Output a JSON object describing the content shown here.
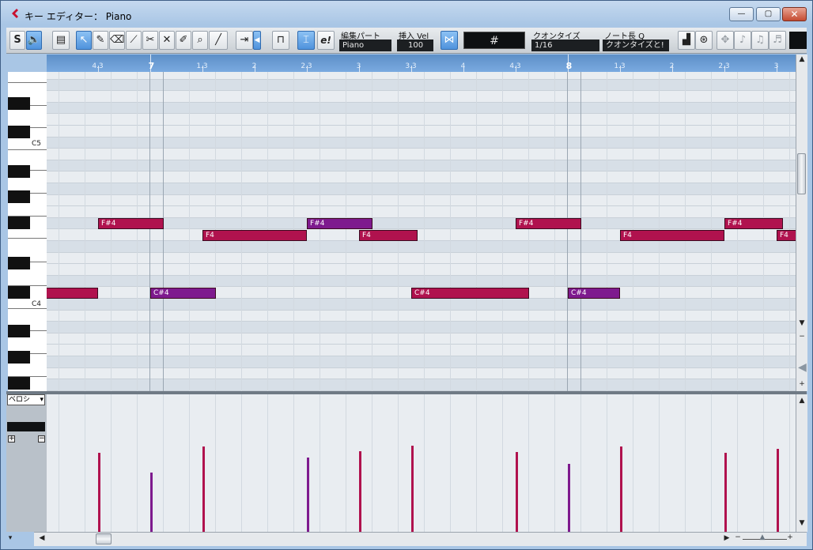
{
  "window": {
    "title": "キー エディター： Piano",
    "minimize_label": "—",
    "maximize_label": "▢",
    "close_label": "✕"
  },
  "toolbar": {
    "solo_label": "S",
    "edit_part_label": "編集パート",
    "edit_part_value": "Piano",
    "insert_vel_label": "挿入 Vel",
    "insert_vel_value": "100",
    "grid_symbol": "#",
    "quantize_label": "クオンタイズ",
    "quantize_value": "1/16",
    "note_length_label": "ノート長 Q",
    "note_length_value": "クオンタイズと!",
    "eu_label": "e!"
  },
  "ruler": {
    "labels": [
      {
        "text": "4.3",
        "bar": false
      },
      {
        "text": "7",
        "bar": true
      },
      {
        "text": "1.3",
        "bar": false
      },
      {
        "text": "2",
        "bar": false
      },
      {
        "text": "2.3",
        "bar": false
      },
      {
        "text": "3",
        "bar": false
      },
      {
        "text": "3.3",
        "bar": false
      },
      {
        "text": "4",
        "bar": false
      },
      {
        "text": "4.3",
        "bar": false
      },
      {
        "text": "8",
        "bar": true
      },
      {
        "text": "1.3",
        "bar": false
      },
      {
        "text": "2",
        "bar": false
      },
      {
        "text": "2.3",
        "bar": false
      },
      {
        "text": "3",
        "bar": false
      }
    ]
  },
  "keyboard": {
    "c5_label": "C5",
    "c4_label": "C4"
  },
  "notes": [
    {
      "pitch": "F#4",
      "label": "F#4",
      "start": 4.375,
      "length": 0.625,
      "color": "#b0124e"
    },
    {
      "pitch": "F4",
      "label": "F4",
      "start": 5.375,
      "length": 1.0,
      "color": "#b0124e"
    },
    {
      "pitch": "F#4",
      "label": "F#4",
      "start": 6.375,
      "length": 0.625,
      "color": "#7e1a8e"
    },
    {
      "pitch": "F4",
      "label": "F4",
      "start": 6.875,
      "length": 0.5625,
      "color": "#b0124e"
    },
    {
      "pitch": "F#4",
      "label": "F#4",
      "start": 8.375,
      "length": 0.625,
      "color": "#b0124e"
    },
    {
      "pitch": "F4",
      "label": "F4",
      "start": 9.375,
      "length": 1.0,
      "color": "#b0124e"
    },
    {
      "pitch": "F#4",
      "label": "F#4",
      "start": 10.375,
      "length": 0.5625,
      "color": "#b0124e"
    },
    {
      "pitch": "F4",
      "label": "F4",
      "start": 10.875,
      "length": 0.25,
      "color": "#b0124e"
    },
    {
      "pitch": "C#4",
      "label": "",
      "start": 3.875,
      "length": 0.5,
      "color": "#b0124e"
    },
    {
      "pitch": "C#4",
      "label": "C#4",
      "start": 4.875,
      "length": 0.625,
      "color": "#7e1a8e"
    },
    {
      "pitch": "C#4",
      "label": "C#4",
      "start": 7.375,
      "length": 1.125,
      "color": "#b0124e"
    },
    {
      "pitch": "C#4",
      "label": "C#4",
      "start": 8.875,
      "length": 0.5,
      "color": "#7e1a8e"
    }
  ],
  "velocity_panel": {
    "selector_label": "ベロシ",
    "plus_label": "+",
    "minus_label": "−",
    "bars": [
      {
        "start": 4.375,
        "velocity": 100,
        "color": "#b0124e"
      },
      {
        "start": 4.875,
        "velocity": 75,
        "color": "#7e1a8e"
      },
      {
        "start": 5.375,
        "velocity": 108,
        "color": "#b0124e"
      },
      {
        "start": 6.375,
        "velocity": 94,
        "color": "#7e1a8e"
      },
      {
        "start": 6.875,
        "velocity": 102,
        "color": "#b0124e"
      },
      {
        "start": 7.375,
        "velocity": 109,
        "color": "#b0124e"
      },
      {
        "start": 8.375,
        "velocity": 101,
        "color": "#b0124e"
      },
      {
        "start": 8.875,
        "velocity": 86,
        "color": "#7e1a8e"
      },
      {
        "start": 9.375,
        "velocity": 108,
        "color": "#b0124e"
      },
      {
        "start": 10.375,
        "velocity": 100,
        "color": "#b0124e"
      },
      {
        "start": 10.875,
        "velocity": 105,
        "color": "#b0124e"
      }
    ]
  }
}
